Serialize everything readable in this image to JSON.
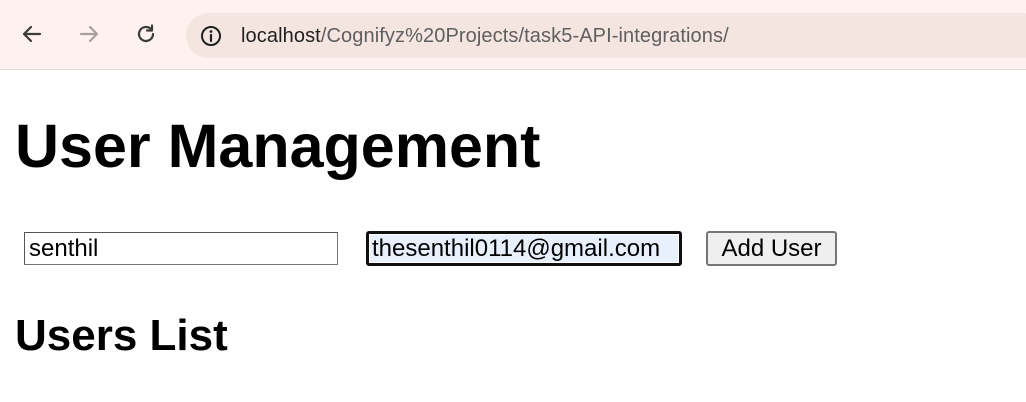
{
  "browser": {
    "url_host": "localhost",
    "url_path": "/Cognifyz%20Projects/task5-API-integrations/",
    "icons": {
      "back": "arrow-left-icon",
      "forward": "arrow-right-icon",
      "reload": "reload-icon",
      "site_info": "info-icon"
    }
  },
  "page": {
    "title": "User Management",
    "form": {
      "name_value": "senthil",
      "email_value": "thesenthil0114@gmail.com",
      "submit_label": "Add User"
    },
    "list_heading": "Users List"
  }
}
